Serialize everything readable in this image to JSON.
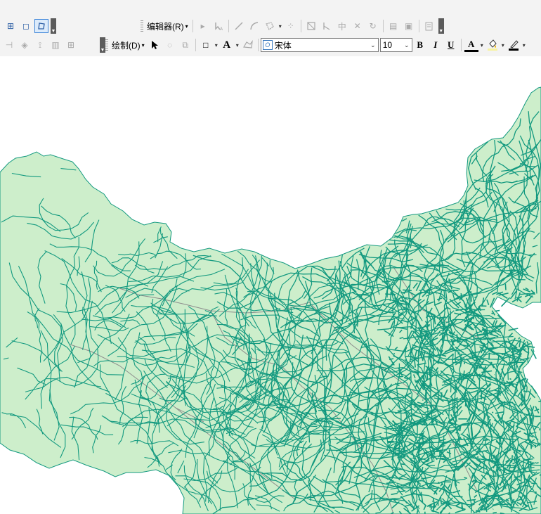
{
  "toolbar_row1": {
    "editor_menu_label": "编辑器(R)"
  },
  "toolbar_row2": {
    "draw_menu_label": "绘制(D)",
    "font_name": "宋体",
    "font_size": "10",
    "bold_label": "B",
    "italic_label": "I",
    "underline_label": "U",
    "font_color_label": "A"
  },
  "colors": {
    "land_fill": "#cdeecb",
    "road_line": "#12997f",
    "boundary_line": "#8c8c8c",
    "toolbar_bg": "#f3f3f3",
    "accent": "#3f86d9"
  },
  "icons": [
    "grid-icon",
    "square-icon",
    "edit-vertices-icon",
    "play-icon",
    "edit-annotation-icon",
    "straight-segment-icon",
    "arc-icon",
    "polygon-tool-icon",
    "points-icon",
    "reshape-icon",
    "split-icon",
    "cut-polygon-icon",
    "rotate-icon",
    "attributes-icon",
    "sketch-properties-icon",
    "create-features-icon",
    "select-pointer-icon",
    "rotate-element-icon",
    "zoom-element-icon",
    "rectangle-icon",
    "text-tool-icon",
    "edit-vertices-graphic-icon",
    "font-icon",
    "bold-icon",
    "italic-icon",
    "underline-icon",
    "font-color-icon",
    "fill-color-icon",
    "line-color-icon"
  ]
}
